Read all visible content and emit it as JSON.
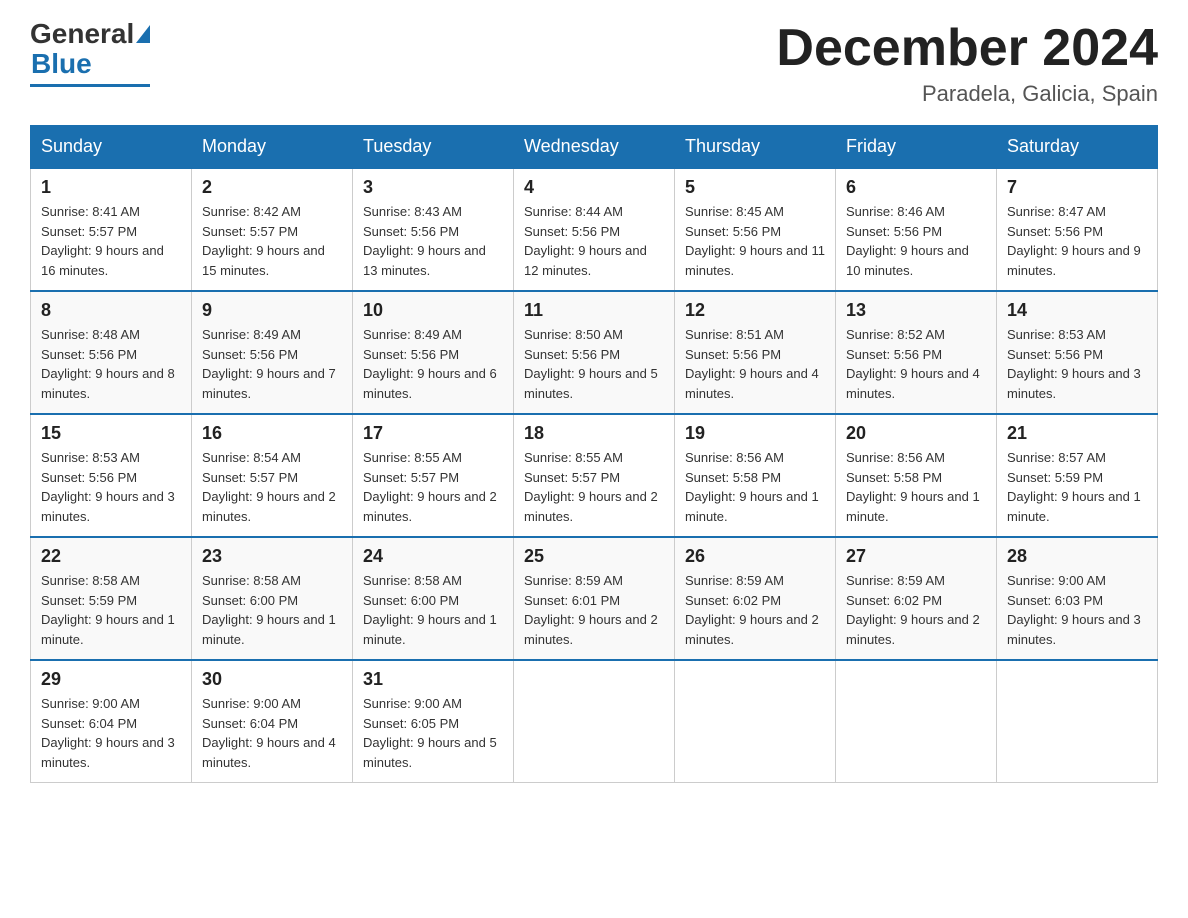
{
  "logo": {
    "general": "General",
    "blue": "Blue"
  },
  "title": "December 2024",
  "subtitle": "Paradela, Galicia, Spain",
  "days_of_week": [
    "Sunday",
    "Monday",
    "Tuesday",
    "Wednesday",
    "Thursday",
    "Friday",
    "Saturday"
  ],
  "weeks": [
    [
      {
        "day": "1",
        "sunrise": "8:41 AM",
        "sunset": "5:57 PM",
        "daylight": "9 hours and 16 minutes."
      },
      {
        "day": "2",
        "sunrise": "8:42 AM",
        "sunset": "5:57 PM",
        "daylight": "9 hours and 15 minutes."
      },
      {
        "day": "3",
        "sunrise": "8:43 AM",
        "sunset": "5:56 PM",
        "daylight": "9 hours and 13 minutes."
      },
      {
        "day": "4",
        "sunrise": "8:44 AM",
        "sunset": "5:56 PM",
        "daylight": "9 hours and 12 minutes."
      },
      {
        "day": "5",
        "sunrise": "8:45 AM",
        "sunset": "5:56 PM",
        "daylight": "9 hours and 11 minutes."
      },
      {
        "day": "6",
        "sunrise": "8:46 AM",
        "sunset": "5:56 PM",
        "daylight": "9 hours and 10 minutes."
      },
      {
        "day": "7",
        "sunrise": "8:47 AM",
        "sunset": "5:56 PM",
        "daylight": "9 hours and 9 minutes."
      }
    ],
    [
      {
        "day": "8",
        "sunrise": "8:48 AM",
        "sunset": "5:56 PM",
        "daylight": "9 hours and 8 minutes."
      },
      {
        "day": "9",
        "sunrise": "8:49 AM",
        "sunset": "5:56 PM",
        "daylight": "9 hours and 7 minutes."
      },
      {
        "day": "10",
        "sunrise": "8:49 AM",
        "sunset": "5:56 PM",
        "daylight": "9 hours and 6 minutes."
      },
      {
        "day": "11",
        "sunrise": "8:50 AM",
        "sunset": "5:56 PM",
        "daylight": "9 hours and 5 minutes."
      },
      {
        "day": "12",
        "sunrise": "8:51 AM",
        "sunset": "5:56 PM",
        "daylight": "9 hours and 4 minutes."
      },
      {
        "day": "13",
        "sunrise": "8:52 AM",
        "sunset": "5:56 PM",
        "daylight": "9 hours and 4 minutes."
      },
      {
        "day": "14",
        "sunrise": "8:53 AM",
        "sunset": "5:56 PM",
        "daylight": "9 hours and 3 minutes."
      }
    ],
    [
      {
        "day": "15",
        "sunrise": "8:53 AM",
        "sunset": "5:56 PM",
        "daylight": "9 hours and 3 minutes."
      },
      {
        "day": "16",
        "sunrise": "8:54 AM",
        "sunset": "5:57 PM",
        "daylight": "9 hours and 2 minutes."
      },
      {
        "day": "17",
        "sunrise": "8:55 AM",
        "sunset": "5:57 PM",
        "daylight": "9 hours and 2 minutes."
      },
      {
        "day": "18",
        "sunrise": "8:55 AM",
        "sunset": "5:57 PM",
        "daylight": "9 hours and 2 minutes."
      },
      {
        "day": "19",
        "sunrise": "8:56 AM",
        "sunset": "5:58 PM",
        "daylight": "9 hours and 1 minute."
      },
      {
        "day": "20",
        "sunrise": "8:56 AM",
        "sunset": "5:58 PM",
        "daylight": "9 hours and 1 minute."
      },
      {
        "day": "21",
        "sunrise": "8:57 AM",
        "sunset": "5:59 PM",
        "daylight": "9 hours and 1 minute."
      }
    ],
    [
      {
        "day": "22",
        "sunrise": "8:58 AM",
        "sunset": "5:59 PM",
        "daylight": "9 hours and 1 minute."
      },
      {
        "day": "23",
        "sunrise": "8:58 AM",
        "sunset": "6:00 PM",
        "daylight": "9 hours and 1 minute."
      },
      {
        "day": "24",
        "sunrise": "8:58 AM",
        "sunset": "6:00 PM",
        "daylight": "9 hours and 1 minute."
      },
      {
        "day": "25",
        "sunrise": "8:59 AM",
        "sunset": "6:01 PM",
        "daylight": "9 hours and 2 minutes."
      },
      {
        "day": "26",
        "sunrise": "8:59 AM",
        "sunset": "6:02 PM",
        "daylight": "9 hours and 2 minutes."
      },
      {
        "day": "27",
        "sunrise": "8:59 AM",
        "sunset": "6:02 PM",
        "daylight": "9 hours and 2 minutes."
      },
      {
        "day": "28",
        "sunrise": "9:00 AM",
        "sunset": "6:03 PM",
        "daylight": "9 hours and 3 minutes."
      }
    ],
    [
      {
        "day": "29",
        "sunrise": "9:00 AM",
        "sunset": "6:04 PM",
        "daylight": "9 hours and 3 minutes."
      },
      {
        "day": "30",
        "sunrise": "9:00 AM",
        "sunset": "6:04 PM",
        "daylight": "9 hours and 4 minutes."
      },
      {
        "day": "31",
        "sunrise": "9:00 AM",
        "sunset": "6:05 PM",
        "daylight": "9 hours and 5 minutes."
      },
      null,
      null,
      null,
      null
    ]
  ]
}
